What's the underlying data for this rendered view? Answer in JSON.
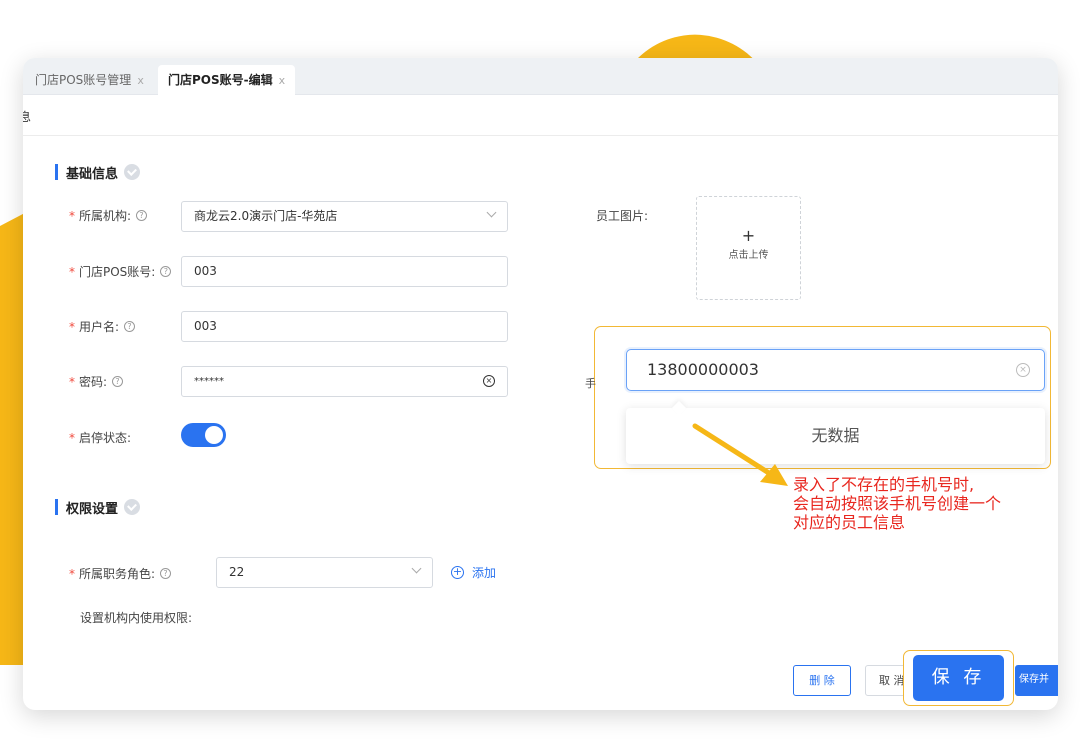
{
  "tabs": [
    {
      "label": "门店POS账号管理",
      "close": "x"
    },
    {
      "label": "门店POS账号-编辑",
      "close": "x"
    }
  ],
  "breadcrumb": "息",
  "sections": {
    "basic": "基础信息",
    "permission": "权限设置"
  },
  "form": {
    "org": {
      "label": "所属机构:",
      "value": "商龙云2.0演示门店-华苑店"
    },
    "pos_account": {
      "label": "门店POS账号:",
      "value": "003"
    },
    "username": {
      "label": "用户名:",
      "value": "003"
    },
    "password": {
      "label": "密码:",
      "value": "******"
    },
    "status": {
      "label": "启停状态:",
      "on": true
    },
    "role": {
      "label": "所属职务角色:",
      "value": "22",
      "add": "添加"
    },
    "perm_hint": "设置机构内使用权限:",
    "photo": {
      "label": "员工图片:",
      "plus": "+",
      "upload": "点击上传"
    },
    "phone_label": "手"
  },
  "popup": {
    "phone": "13800000003",
    "empty": "无数据"
  },
  "annotation": [
    "录入了不存在的手机号时,",
    "会自动按照该手机号创建一个",
    "对应的员工信息"
  ],
  "buttons": {
    "delete": "删 除",
    "cancel": "取 消",
    "save": "保 存",
    "save_all": "保存并"
  },
  "colors": {
    "accent": "#2a73f0",
    "highlight": "#f2b835",
    "annotation": "#e8271f",
    "deco": "#f6b717"
  }
}
